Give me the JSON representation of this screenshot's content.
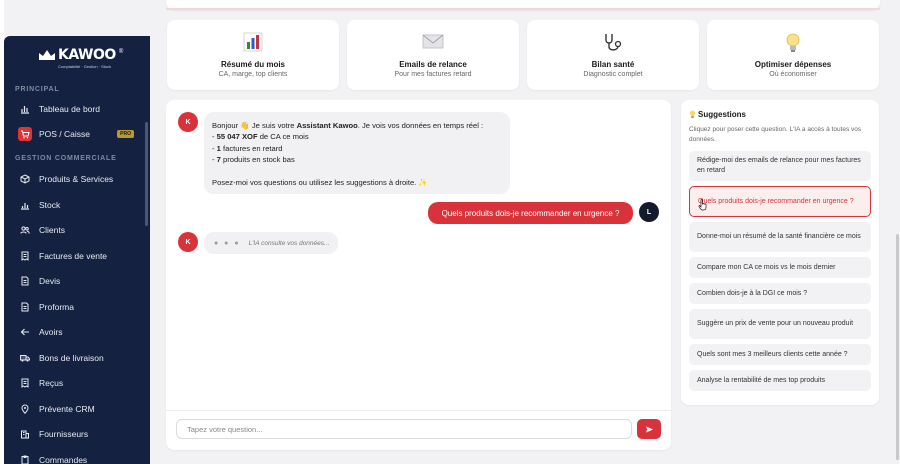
{
  "brand": {
    "name": "KAWOO",
    "tagline": "Comptabilité · Gestion · Stock",
    "color": "#d8323a"
  },
  "sidebar": {
    "section_principal": "PRINCIPAL",
    "section_gestion": "GESTION COMMERCIALE",
    "pro_badge": "PRO",
    "items": [
      {
        "label": "Tableau de bord",
        "icon": "chart-bars-icon"
      },
      {
        "label": "POS / Caisse",
        "icon": "cart-icon"
      },
      {
        "label": "Produits & Services",
        "icon": "cube-icon"
      },
      {
        "label": "Stock",
        "icon": "bar-chart-icon"
      },
      {
        "label": "Clients",
        "icon": "users-icon"
      },
      {
        "label": "Factures de vente",
        "icon": "receipt-icon"
      },
      {
        "label": "Devis",
        "icon": "document-icon"
      },
      {
        "label": "Proforma",
        "icon": "document-icon"
      },
      {
        "label": "Avoirs",
        "icon": "arrow-left-icon"
      },
      {
        "label": "Bons de livraison",
        "icon": "truck-icon"
      },
      {
        "label": "Reçus",
        "icon": "receipt-icon"
      },
      {
        "label": "Prévente CRM",
        "icon": "map-pin-icon"
      },
      {
        "label": "Fournisseurs",
        "icon": "building-icon"
      },
      {
        "label": "Commandes",
        "icon": "clipboard-icon"
      }
    ]
  },
  "cards": [
    {
      "title": "Résumé du mois",
      "subtitle": "CA, marge, top clients",
      "icon": "bar-chart-icon"
    },
    {
      "title": "Emails de relance",
      "subtitle": "Pour mes factures retard",
      "icon": "envelope-icon"
    },
    {
      "title": "Bilan santé",
      "subtitle": "Diagnostic complet",
      "icon": "stethoscope-icon"
    },
    {
      "title": "Optimiser dépenses",
      "subtitle": "Où économiser",
      "icon": "lightbulb-icon"
    }
  ],
  "chat": {
    "ai_avatar": "K",
    "user_avatar": "L",
    "ai_message": {
      "greeting": "Bonjour 👋 Je suis votre ",
      "assistant_name": "Assistant Kawoo",
      "intro_end": ". Je vois vos données en temps réel :",
      "line1_value": "55 047 XOF",
      "line1_rest": " de CA ce mois",
      "line2_value": "1",
      "line2_rest": " factures en retard",
      "line3_value": "7",
      "line3_rest": " produits en stock bas",
      "outro": "Posez-moi vos questions ou utilisez les suggestions à droite. ✨"
    },
    "user_message": "Quels produits dois-je recommander en urgence ?",
    "typing_dots": "● ● ●",
    "typing_text": "L'IA consulte vos données...",
    "input_placeholder": "Tapez votre question..."
  },
  "suggestions": {
    "title": "Suggestions",
    "description": "Cliquez pour poser cette question. L'IA a accès à toutes vos données.",
    "items": [
      "Rédige-moi des emails de relance pour mes factures en retard",
      "Quels produits dois-je recommander en urgence ?",
      "Donne-moi un résumé de la santé financière ce mois",
      "Compare mon CA ce mois vs le mois dernier",
      "Combien dois-je à la DGI ce mois ?",
      "Suggère un prix de vente pour un nouveau produit",
      "Quels sont mes 3 meilleurs clients cette année ?",
      "Analyse la rentabilité de mes top produits"
    ],
    "active_index": 1
  }
}
